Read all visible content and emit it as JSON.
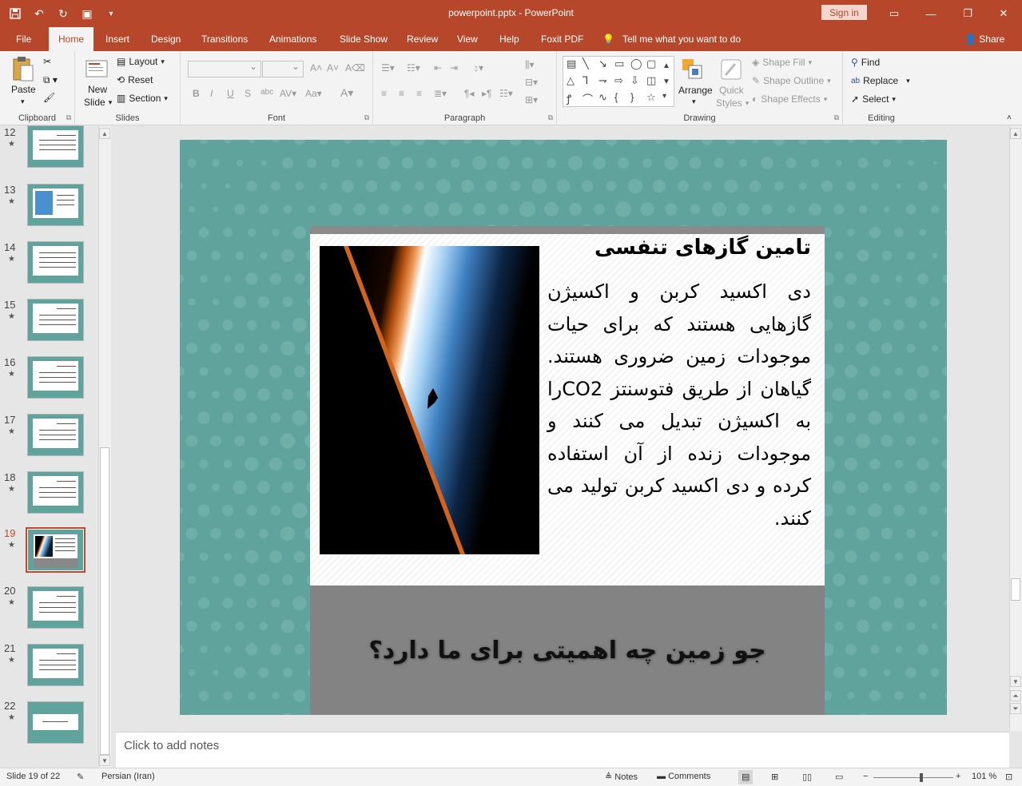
{
  "titlebar": {
    "doc_name": "powerpoint.pptx",
    "separator": " - ",
    "app_name": "PowerPoint",
    "signin_label": "Sign in"
  },
  "tabs": [
    {
      "label": "File"
    },
    {
      "label": "Home"
    },
    {
      "label": "Insert"
    },
    {
      "label": "Design"
    },
    {
      "label": "Transitions"
    },
    {
      "label": "Animations"
    },
    {
      "label": "Slide Show"
    },
    {
      "label": "Review"
    },
    {
      "label": "View"
    },
    {
      "label": "Help"
    },
    {
      "label": "Foxit PDF"
    }
  ],
  "tellme": "Tell me what you want to do",
  "share": "Share",
  "ribbon": {
    "clipboard": {
      "paste": "Paste",
      "label": "Clipboard"
    },
    "slides": {
      "new_slide_1": "New",
      "new_slide_2": "Slide",
      "layout": "Layout",
      "reset": "Reset",
      "section": "Section",
      "label": "Slides"
    },
    "font": {
      "label": "Font"
    },
    "paragraph": {
      "label": "Paragraph"
    },
    "drawing": {
      "arrange": "Arrange",
      "quick_styles_1": "Quick",
      "quick_styles_2": "Styles",
      "shape_fill": "Shape Fill",
      "shape_outline": "Shape Outline",
      "shape_effects": "Shape Effects",
      "label": "Drawing"
    },
    "editing": {
      "find": "Find",
      "replace": "Replace",
      "select": "Select",
      "label": "Editing"
    }
  },
  "thumbnails": [
    {
      "number": "12"
    },
    {
      "number": "13"
    },
    {
      "number": "14"
    },
    {
      "number": "15"
    },
    {
      "number": "16"
    },
    {
      "number": "17"
    },
    {
      "number": "18"
    },
    {
      "number": "19"
    },
    {
      "number": "20"
    },
    {
      "number": "21"
    },
    {
      "number": "22"
    }
  ],
  "selected_slide": "19",
  "slide": {
    "title": "تامین گازهای تنفسی",
    "body": "دی اکسید کربن و اکسیژن گازهایی هستند که برای حیات موجودات زمین ضروری هستند. گیاهان از طریق فتوسنتز CO2را به اکسیژن تبدیل می کنند و موجودات زنده از آن استفاده کرده و دی اکسید کربن تولید می کنند.",
    "band": "جو زمین چه اهمیتی برای ما دارد؟"
  },
  "notes_placeholder": "Click to add notes",
  "status": {
    "slide_info": "Slide 19 of 22",
    "language": "Persian (Iran)",
    "notes": "Notes",
    "comments": "Comments",
    "zoom": "101 %",
    "zoom_level": 0.6
  },
  "colors": {
    "accent": "#b7472a",
    "slide_bg": "#5fa39c",
    "band": "#838383"
  }
}
